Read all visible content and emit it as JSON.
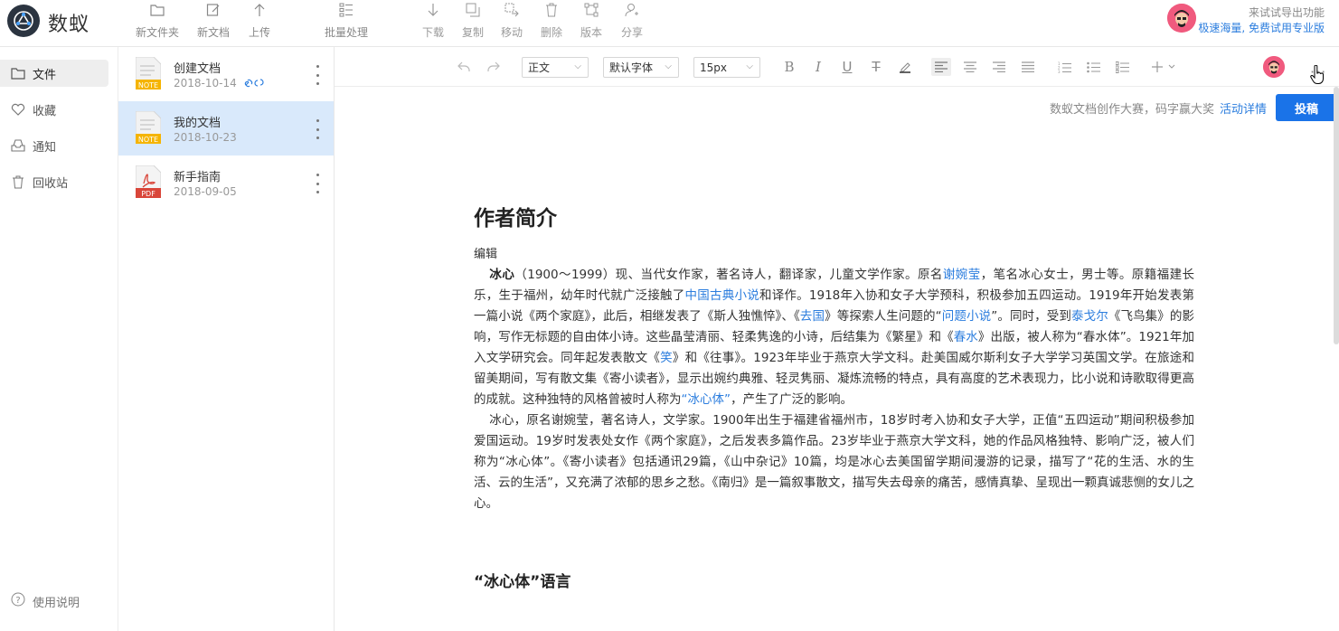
{
  "app": {
    "name": "数蚁"
  },
  "toolbar": {
    "new_folder": "新文件夹",
    "new_doc": "新文档",
    "upload": "上传",
    "batch": "批量处理",
    "download": "下载",
    "copy": "复制",
    "move": "移动",
    "delete": "删除",
    "version": "版本",
    "share": "分享"
  },
  "promo": {
    "line1": "来试试导出功能",
    "line2": "极速海量, 免费试用专业版"
  },
  "sidebar": {
    "items": [
      {
        "label": "文件",
        "icon": "folder-icon"
      },
      {
        "label": "收藏",
        "icon": "heart-icon"
      },
      {
        "label": "通知",
        "icon": "inbox-icon"
      },
      {
        "label": "回收站",
        "icon": "trash-icon"
      }
    ],
    "help": "使用说明"
  },
  "files": [
    {
      "name": "创建文档",
      "date": "2018-10-14",
      "type": "NOTE",
      "link": "🔗 ⚲"
    },
    {
      "name": "我的文档",
      "date": "2018-10-23",
      "type": "NOTE",
      "link": ""
    },
    {
      "name": "新手指南",
      "date": "2018-09-05",
      "type": "PDF",
      "link": ""
    }
  ],
  "editor_toolbar": {
    "paragraph": "正文",
    "font": "默认字体",
    "size": "15px"
  },
  "contest": {
    "text": "数蚁文档创作大赛，码字赢大奖",
    "link": "活动详情",
    "submit": "投稿"
  },
  "doc": {
    "title": "作者简介",
    "edit": "编辑",
    "p1": {
      "name": "冰心",
      "t1": "（1900～1999）现、当代女作家，著名诗人，翻译家，儿童文学作家。原名",
      "l1": "谢婉莹",
      "t2": "，笔名冰心女士，男士等。原籍福建长乐，生于福州，幼年时代就广泛接触了",
      "l2": "中国古典小说",
      "t3": "和译作。1918年入协和女子大学预科，积极参加五四运动。1919年开始发表第一篇小说《两个家庭》，此后，相继发表了《斯人独憔悴》、《",
      "l3": "去国",
      "t4": "》等探索人生问题的“",
      "l4": "问题小说",
      "t5": "”。同时，受到",
      "l5": "泰戈尔",
      "t6": "《飞鸟集》的影响，写作无标题的自由体小诗。这些晶莹清丽、轻柔隽逸的小诗，后结集为《繁星》和《",
      "l6": "春水",
      "t7": "》出版，被人称为“春水体”。1921年加入文学研究会。同年起发表散文《",
      "l7": "笑",
      "t8": "》和《往事》。1923年毕业于燕京大学文科。赴美国威尔斯利女子大学学习英国文学。在旅途和留美期间，写有散文集《寄小读者》，显示出婉约典雅、轻灵隽丽、凝炼流畅的特点，具有高度的艺术表现力，比小说和诗歌取得更高的成就。这种独特的风格曾被时人称为",
      "l8": "“冰心体”",
      "t9": "，产生了广泛的影响。"
    },
    "p2": "冰心，原名谢婉莹，著名诗人，文学家。1900年出生于福建省福州市，18岁时考入协和女子大学，正值“五四运动”期间积极参加爱国运动。19岁时发表处女作《两个家庭》，之后发表多篇作品。23岁毕业于燕京大学文科，她的作品风格独特、影响广泛，被人们称为“冰心体”。《寄小读者》包括通讯29篇，《山中杂记》10篇，均是冰心去美国留学期间漫游的记录，描写了“花的生活、水的生活、云的生活”，又充满了浓郁的思乡之愁。《南归》是一篇叙事散文，描写失去母亲的痛苦，感情真挚、呈现出一颗真诚悲恻的女儿之心。",
    "h2": "“冰心体”语言"
  },
  "colors": {
    "accent": "#1a73e8",
    "link": "#2b7dde",
    "selected": "#d9e9fb"
  }
}
